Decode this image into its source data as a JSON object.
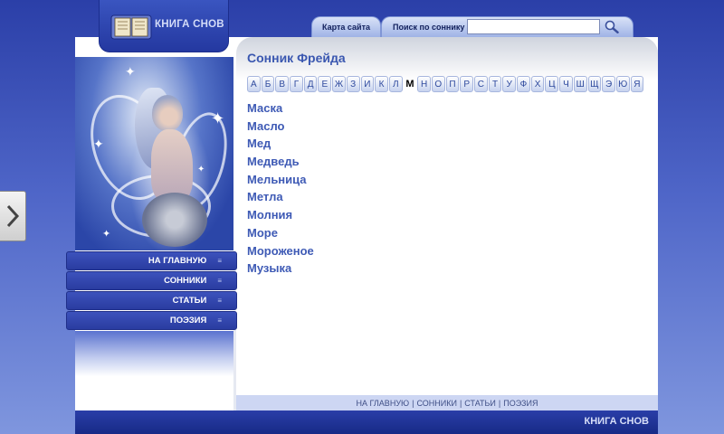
{
  "site": {
    "logo_text": "КНИГА СНОВ",
    "footer_brand": "КНИГА СНОВ"
  },
  "top_nav": {
    "sitemap_label": "Карта сайта",
    "search_label": "Поиск по соннику",
    "search_value": "",
    "search_placeholder": ""
  },
  "side_menu": {
    "items": [
      {
        "label": "НА ГЛАВНУЮ"
      },
      {
        "label": "СОННИКИ"
      },
      {
        "label": "СТАТЬИ"
      },
      {
        "label": "ПОЭЗИЯ"
      }
    ]
  },
  "content": {
    "title": "Сонник Фрейда",
    "alphabet": [
      "А",
      "Б",
      "В",
      "Г",
      "Д",
      "Е",
      "Ж",
      "З",
      "И",
      "К",
      "Л",
      "М",
      "Н",
      "О",
      "П",
      "Р",
      "С",
      "Т",
      "У",
      "Ф",
      "Х",
      "Ц",
      "Ч",
      "Ш",
      "Щ",
      "Э",
      "Ю",
      "Я"
    ],
    "active_letter": "М",
    "dreams": [
      "Маска",
      "Масло",
      "Мед",
      "Медведь",
      "Мельница",
      "Метла",
      "Молния",
      "Море",
      "Мороженое",
      "Музыка"
    ]
  },
  "footer": {
    "links": [
      "НА ГЛАВНУЮ",
      "СОННИКИ",
      "СТАТЬИ",
      "ПОЭЗИЯ"
    ],
    "separator": "|"
  },
  "icons": {
    "side_handle": "chevron-right-icon",
    "search_button": "magnifier-icon",
    "logo": "open-book-icon",
    "menu_bullet": "menu-bullet-icon"
  },
  "colors": {
    "brand_blue": "#2a3ca0",
    "title_blue": "#3a57b0",
    "link_blue": "#3e5ab5"
  }
}
